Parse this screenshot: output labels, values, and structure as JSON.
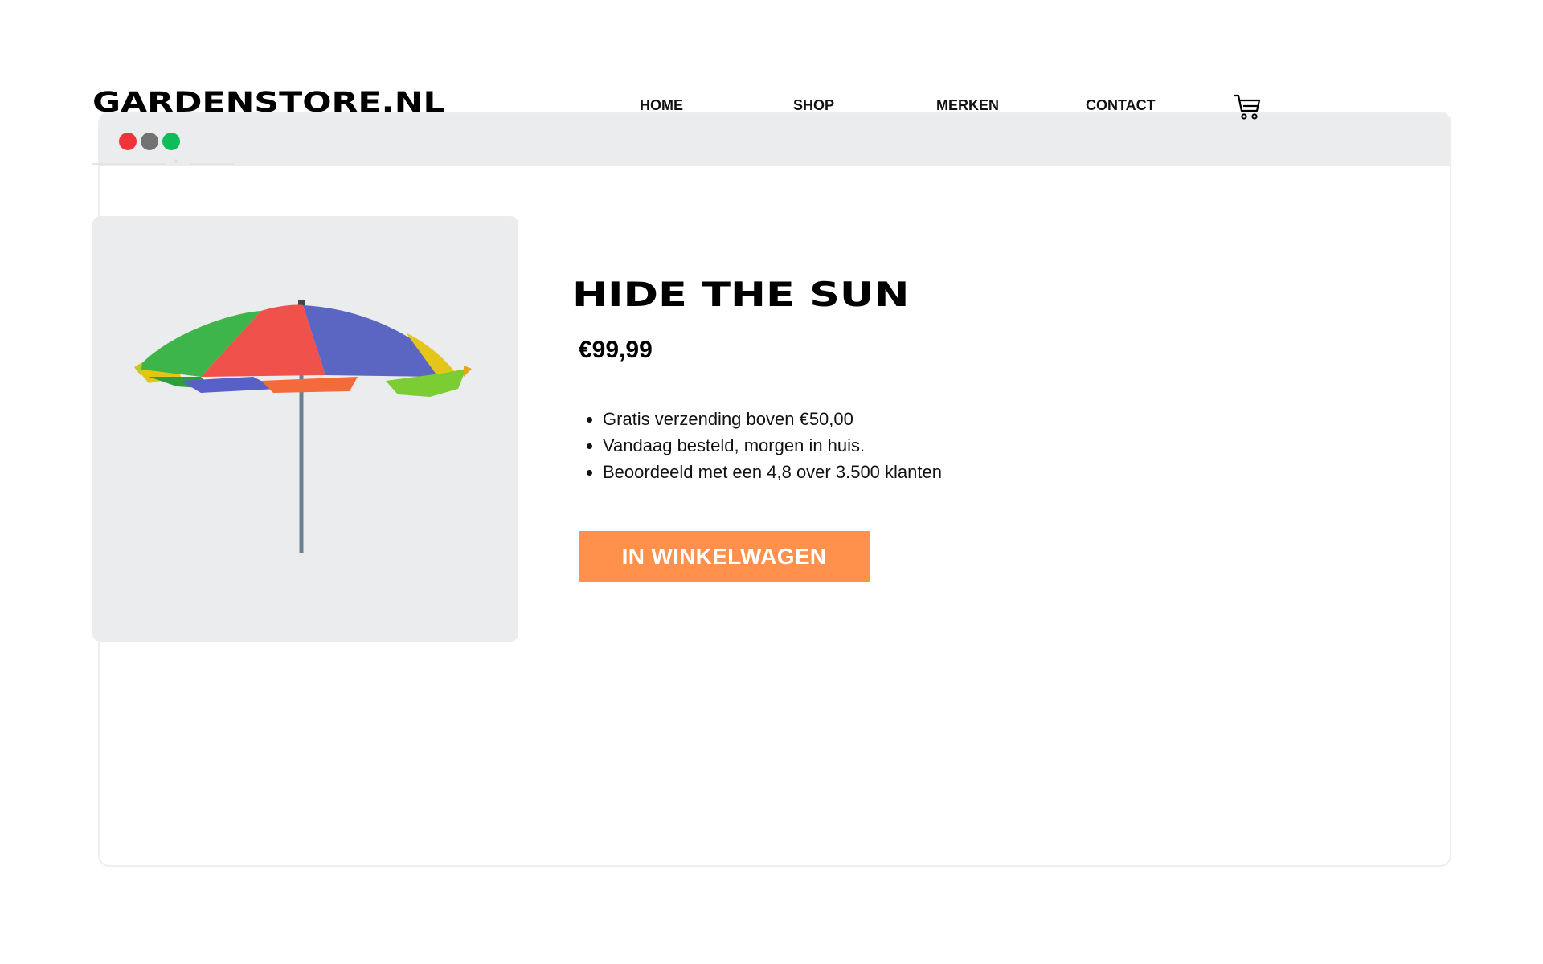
{
  "window": {
    "controls": [
      "close",
      "minimize",
      "maximize"
    ],
    "control_colors": [
      "#f1343a",
      "#727272",
      "#0dbd5a"
    ]
  },
  "header": {
    "logo": "GARDENSTORE.NL",
    "nav": [
      {
        "label": "HOME"
      },
      {
        "label": "SHOP"
      },
      {
        "label": "MERKEN"
      },
      {
        "label": "CONTACT"
      }
    ],
    "cart_icon": "shopping-cart-icon"
  },
  "breadcrumb": {
    "separator": ">"
  },
  "product": {
    "image_subject": "colorful beach umbrella",
    "title": "HIDE THE SUN",
    "price": "€99,99",
    "features": [
      "Gratis verzending boven €50,00",
      "Vandaag besteld, morgen in huis.",
      "Beoordeeld met een 4,8 over 3.500 klanten"
    ],
    "cta_label": "IN WINKELWAGEN"
  },
  "colors": {
    "accent": "#ff914d",
    "panel": "#ebeced",
    "text": "#000000"
  }
}
